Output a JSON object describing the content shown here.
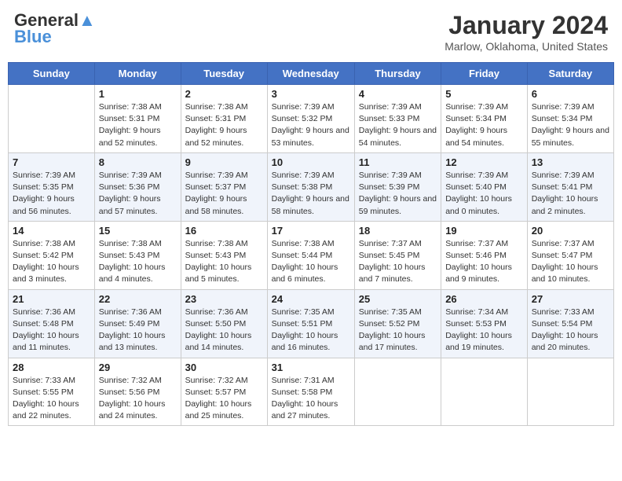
{
  "header": {
    "logo_line1": "General",
    "logo_line2": "Blue",
    "month_title": "January 2024",
    "location": "Marlow, Oklahoma, United States"
  },
  "days_of_week": [
    "Sunday",
    "Monday",
    "Tuesday",
    "Wednesday",
    "Thursday",
    "Friday",
    "Saturday"
  ],
  "weeks": [
    [
      {
        "day": "",
        "sunrise": "",
        "sunset": "",
        "daylight": ""
      },
      {
        "day": "1",
        "sunrise": "Sunrise: 7:38 AM",
        "sunset": "Sunset: 5:31 PM",
        "daylight": "Daylight: 9 hours and 52 minutes."
      },
      {
        "day": "2",
        "sunrise": "Sunrise: 7:38 AM",
        "sunset": "Sunset: 5:31 PM",
        "daylight": "Daylight: 9 hours and 52 minutes."
      },
      {
        "day": "3",
        "sunrise": "Sunrise: 7:39 AM",
        "sunset": "Sunset: 5:32 PM",
        "daylight": "Daylight: 9 hours and 53 minutes."
      },
      {
        "day": "4",
        "sunrise": "Sunrise: 7:39 AM",
        "sunset": "Sunset: 5:33 PM",
        "daylight": "Daylight: 9 hours and 54 minutes."
      },
      {
        "day": "5",
        "sunrise": "Sunrise: 7:39 AM",
        "sunset": "Sunset: 5:34 PM",
        "daylight": "Daylight: 9 hours and 54 minutes."
      },
      {
        "day": "6",
        "sunrise": "Sunrise: 7:39 AM",
        "sunset": "Sunset: 5:34 PM",
        "daylight": "Daylight: 9 hours and 55 minutes."
      }
    ],
    [
      {
        "day": "7",
        "sunrise": "Sunrise: 7:39 AM",
        "sunset": "Sunset: 5:35 PM",
        "daylight": "Daylight: 9 hours and 56 minutes."
      },
      {
        "day": "8",
        "sunrise": "Sunrise: 7:39 AM",
        "sunset": "Sunset: 5:36 PM",
        "daylight": "Daylight: 9 hours and 57 minutes."
      },
      {
        "day": "9",
        "sunrise": "Sunrise: 7:39 AM",
        "sunset": "Sunset: 5:37 PM",
        "daylight": "Daylight: 9 hours and 58 minutes."
      },
      {
        "day": "10",
        "sunrise": "Sunrise: 7:39 AM",
        "sunset": "Sunset: 5:38 PM",
        "daylight": "Daylight: 9 hours and 58 minutes."
      },
      {
        "day": "11",
        "sunrise": "Sunrise: 7:39 AM",
        "sunset": "Sunset: 5:39 PM",
        "daylight": "Daylight: 9 hours and 59 minutes."
      },
      {
        "day": "12",
        "sunrise": "Sunrise: 7:39 AM",
        "sunset": "Sunset: 5:40 PM",
        "daylight": "Daylight: 10 hours and 0 minutes."
      },
      {
        "day": "13",
        "sunrise": "Sunrise: 7:39 AM",
        "sunset": "Sunset: 5:41 PM",
        "daylight": "Daylight: 10 hours and 2 minutes."
      }
    ],
    [
      {
        "day": "14",
        "sunrise": "Sunrise: 7:38 AM",
        "sunset": "Sunset: 5:42 PM",
        "daylight": "Daylight: 10 hours and 3 minutes."
      },
      {
        "day": "15",
        "sunrise": "Sunrise: 7:38 AM",
        "sunset": "Sunset: 5:43 PM",
        "daylight": "Daylight: 10 hours and 4 minutes."
      },
      {
        "day": "16",
        "sunrise": "Sunrise: 7:38 AM",
        "sunset": "Sunset: 5:43 PM",
        "daylight": "Daylight: 10 hours and 5 minutes."
      },
      {
        "day": "17",
        "sunrise": "Sunrise: 7:38 AM",
        "sunset": "Sunset: 5:44 PM",
        "daylight": "Daylight: 10 hours and 6 minutes."
      },
      {
        "day": "18",
        "sunrise": "Sunrise: 7:37 AM",
        "sunset": "Sunset: 5:45 PM",
        "daylight": "Daylight: 10 hours and 7 minutes."
      },
      {
        "day": "19",
        "sunrise": "Sunrise: 7:37 AM",
        "sunset": "Sunset: 5:46 PM",
        "daylight": "Daylight: 10 hours and 9 minutes."
      },
      {
        "day": "20",
        "sunrise": "Sunrise: 7:37 AM",
        "sunset": "Sunset: 5:47 PM",
        "daylight": "Daylight: 10 hours and 10 minutes."
      }
    ],
    [
      {
        "day": "21",
        "sunrise": "Sunrise: 7:36 AM",
        "sunset": "Sunset: 5:48 PM",
        "daylight": "Daylight: 10 hours and 11 minutes."
      },
      {
        "day": "22",
        "sunrise": "Sunrise: 7:36 AM",
        "sunset": "Sunset: 5:49 PM",
        "daylight": "Daylight: 10 hours and 13 minutes."
      },
      {
        "day": "23",
        "sunrise": "Sunrise: 7:36 AM",
        "sunset": "Sunset: 5:50 PM",
        "daylight": "Daylight: 10 hours and 14 minutes."
      },
      {
        "day": "24",
        "sunrise": "Sunrise: 7:35 AM",
        "sunset": "Sunset: 5:51 PM",
        "daylight": "Daylight: 10 hours and 16 minutes."
      },
      {
        "day": "25",
        "sunrise": "Sunrise: 7:35 AM",
        "sunset": "Sunset: 5:52 PM",
        "daylight": "Daylight: 10 hours and 17 minutes."
      },
      {
        "day": "26",
        "sunrise": "Sunrise: 7:34 AM",
        "sunset": "Sunset: 5:53 PM",
        "daylight": "Daylight: 10 hours and 19 minutes."
      },
      {
        "day": "27",
        "sunrise": "Sunrise: 7:33 AM",
        "sunset": "Sunset: 5:54 PM",
        "daylight": "Daylight: 10 hours and 20 minutes."
      }
    ],
    [
      {
        "day": "28",
        "sunrise": "Sunrise: 7:33 AM",
        "sunset": "Sunset: 5:55 PM",
        "daylight": "Daylight: 10 hours and 22 minutes."
      },
      {
        "day": "29",
        "sunrise": "Sunrise: 7:32 AM",
        "sunset": "Sunset: 5:56 PM",
        "daylight": "Daylight: 10 hours and 24 minutes."
      },
      {
        "day": "30",
        "sunrise": "Sunrise: 7:32 AM",
        "sunset": "Sunset: 5:57 PM",
        "daylight": "Daylight: 10 hours and 25 minutes."
      },
      {
        "day": "31",
        "sunrise": "Sunrise: 7:31 AM",
        "sunset": "Sunset: 5:58 PM",
        "daylight": "Daylight: 10 hours and 27 minutes."
      },
      {
        "day": "",
        "sunrise": "",
        "sunset": "",
        "daylight": ""
      },
      {
        "day": "",
        "sunrise": "",
        "sunset": "",
        "daylight": ""
      },
      {
        "day": "",
        "sunrise": "",
        "sunset": "",
        "daylight": ""
      }
    ]
  ]
}
